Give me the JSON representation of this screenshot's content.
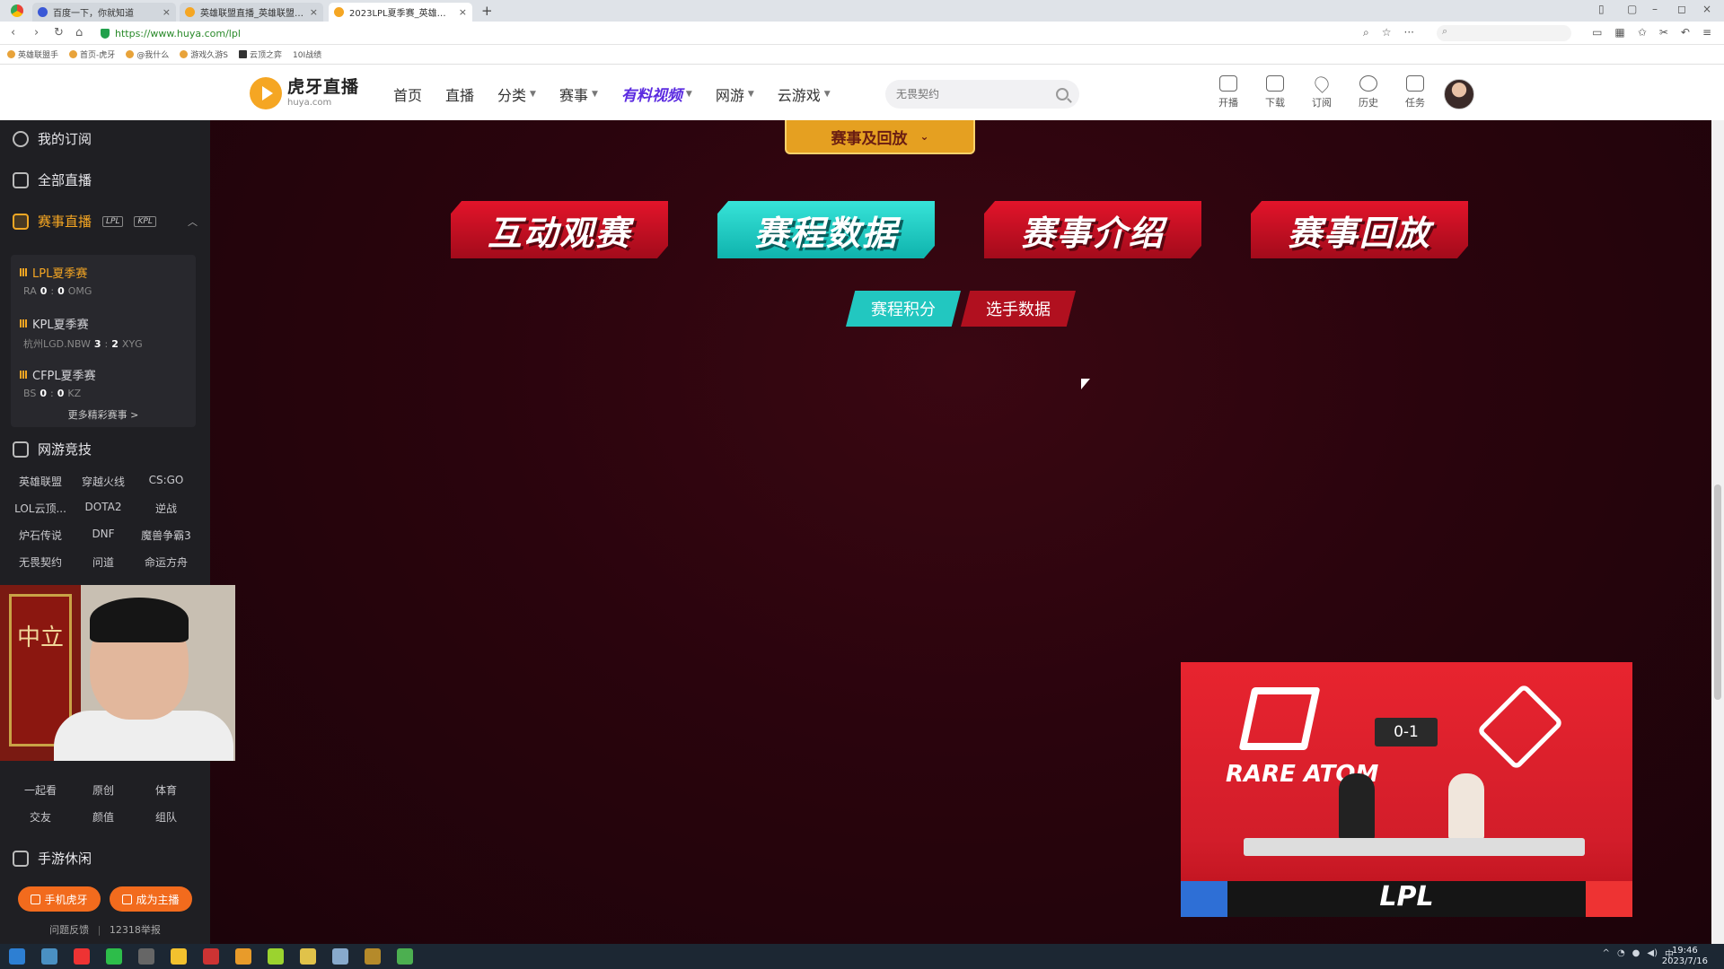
{
  "browser": {
    "tabs": [
      {
        "title": "百度一下，你就知道",
        "active": false,
        "favicon": "baidu-icon"
      },
      {
        "title": "英雄联盟直播_英雄联盟无限",
        "active": false,
        "favicon": "huya-icon"
      },
      {
        "title": "2023LPL夏季赛_英雄联盟",
        "active": true,
        "favicon": "huya-icon"
      }
    ],
    "url": "https://www.huya.com/lpl",
    "bookmarks": [
      "英雄联盟手",
      "首页-虎牙",
      "@我什么",
      "游戏久游S",
      "云顶之弈",
      "10I战绩"
    ]
  },
  "header": {
    "logo_cn": "虎牙直播",
    "logo_en": "huya.com",
    "nav": [
      {
        "label": "首页",
        "dropdown": false,
        "highlight": false
      },
      {
        "label": "直播",
        "dropdown": false,
        "highlight": false
      },
      {
        "label": "分类",
        "dropdown": true,
        "highlight": false
      },
      {
        "label": "赛事",
        "dropdown": true,
        "highlight": false
      },
      {
        "label": "有料视频",
        "dropdown": true,
        "highlight": true
      },
      {
        "label": "网游",
        "dropdown": true,
        "highlight": false
      },
      {
        "label": "云游戏",
        "dropdown": true,
        "highlight": false
      }
    ],
    "search_placeholder": "无畏契约",
    "tools": [
      {
        "label": "开播",
        "icon": "broadcast-icon"
      },
      {
        "label": "下载",
        "icon": "download-icon"
      },
      {
        "label": "订阅",
        "icon": "heart-icon"
      },
      {
        "label": "历史",
        "icon": "history-icon"
      },
      {
        "label": "任务",
        "icon": "task-icon"
      }
    ]
  },
  "sidebar": {
    "my_subscriptions": "我的订阅",
    "all_live": "全部直播",
    "esports_live": "赛事直播",
    "esports_tags": [
      "LPL",
      "KPL"
    ],
    "matches": [
      {
        "name": "LPL夏季赛",
        "team_a": "RA",
        "score_a": "0",
        "score_b": "0",
        "team_b": "OMG",
        "live": true
      },
      {
        "name": "KPL夏季赛",
        "team_a": "杭州LGD.NBW",
        "score_a": "3",
        "score_b": "2",
        "team_b": "XYG",
        "live": false
      },
      {
        "name": "CFPL夏季赛",
        "team_a": "BS",
        "score_a": "0",
        "score_b": "0",
        "team_b": "KZ",
        "live": false
      }
    ],
    "more_matches": "更多精彩赛事 >",
    "online_games_title": "网游竞技",
    "online_games": [
      "英雄联盟",
      "穿越火线",
      "CS:GO",
      "LOL云顶...",
      "DOTA2",
      "逆战",
      "炉石传说",
      "DNF",
      "魔兽争霸3",
      "无畏契约",
      "问道",
      "命运方舟"
    ],
    "entertainment": [
      "一起看",
      "原创",
      "体育",
      "交友",
      "颜值",
      "组队"
    ],
    "mobile_title": "手游休闲",
    "btn_mobile": "手机虎牙",
    "btn_streamer": "成为主播",
    "footer_feedback": "问题反馈",
    "footer_report": "12318举报"
  },
  "main": {
    "section_tab": "赛事及回放",
    "big_tabs": [
      {
        "label": "互动观赛",
        "active": false
      },
      {
        "label": "赛程数据",
        "active": true
      },
      {
        "label": "赛事介绍",
        "active": false
      },
      {
        "label": "赛事回放",
        "active": false
      }
    ],
    "sub_tabs": [
      {
        "label": "赛程积分",
        "active": true
      },
      {
        "label": "选手数据",
        "active": false
      }
    ]
  },
  "mini_player": {
    "team_left": "RARE ATOM",
    "score": "0-1",
    "event_logo": "LPL"
  },
  "webcam": {
    "scroll_text": "中立"
  },
  "taskbar": {
    "time": "19:46",
    "date": "2023/7/16",
    "ime": "中"
  },
  "colors": {
    "brand": "#f5a623",
    "active_tab": "#22c7c0",
    "red_tab": "#d4112a",
    "page_bg": "#2a040d"
  }
}
